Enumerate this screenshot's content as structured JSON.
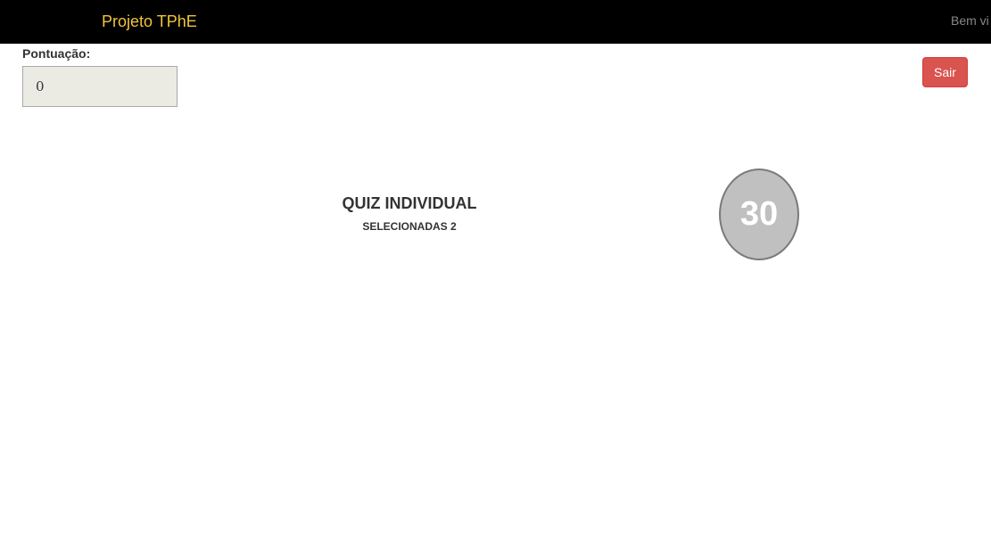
{
  "navbar": {
    "brand": "Projeto TPhE",
    "welcome": "Bem vi"
  },
  "score": {
    "label": "Pontuação:",
    "value": "0"
  },
  "logout": {
    "label": "Sair"
  },
  "quiz": {
    "title": "QUIZ INDIVIDUAL",
    "selected": "SELECIONADAS 2"
  },
  "timer": {
    "value": "30"
  },
  "colors": {
    "navbar_bg": "#000000",
    "brand": "#f0c43c",
    "logout_bg": "#d9534f",
    "timer_bg": "#c0c0c0"
  }
}
